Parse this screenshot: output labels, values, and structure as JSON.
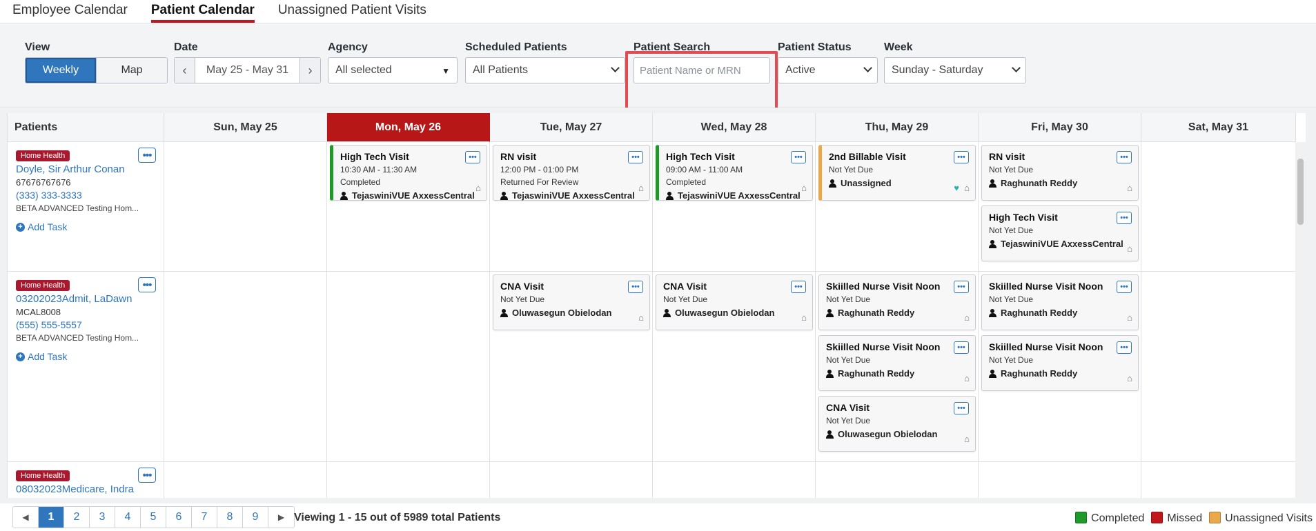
{
  "tabs": [
    "Employee Calendar",
    "Patient Calendar",
    "Unassigned Patient Visits"
  ],
  "filters": {
    "view_label": "View",
    "view_weekly": "Weekly",
    "view_map": "Map",
    "date_label": "Date",
    "date_value": "May 25 - May 31",
    "agency_label": "Agency",
    "agency_value": "All selected",
    "scheduled_label": "Scheduled Patients",
    "scheduled_value": "All Patients",
    "search_label": "Patient Search",
    "search_placeholder": "Patient Name or MRN",
    "status_label": "Patient Status",
    "status_value": "Active",
    "week_label": "Week",
    "week_value": "Sunday - Saturday"
  },
  "grid": {
    "patients_header": "Patients",
    "days": [
      "Sun, May 25",
      "Mon, May 26",
      "Tue, May 27",
      "Wed, May 28",
      "Thu, May 29",
      "Fri, May 30",
      "Sat, May 31"
    ]
  },
  "patients": [
    {
      "badge": "Home Health",
      "name": "Doyle, Sir Arthur Conan",
      "mrn": "67676767676",
      "phone": "(333) 333-3333",
      "agency": "BETA ADVANCED Testing Hom...",
      "add_task": "Add Task"
    },
    {
      "badge": "Home Health",
      "name": "03202023Admit, LaDawn",
      "mrn": "MCAL8008",
      "phone": "(555) 555-5557",
      "agency": "BETA ADVANCED Testing Hom...",
      "add_task": "Add Task"
    },
    {
      "badge": "Home Health",
      "name": "08032023Medicare, Indra"
    }
  ],
  "visits": [
    {
      "title": "High Tech Visit",
      "time": "10:30 AM - 11:30 AM",
      "status": "Completed",
      "user": "TejaswiniVUE AxxessCentral"
    },
    {
      "title": "RN visit",
      "time": "12:00 PM - 01:00 PM",
      "status": "Returned For Review",
      "user": "TejaswiniVUE AxxessCentral"
    },
    {
      "title": "High Tech Visit",
      "time": "09:00 AM - 11:00 AM",
      "status": "Completed",
      "user": "TejaswiniVUE AxxessCentral"
    },
    {
      "title": "2nd Billable Visit",
      "status": "Not Yet Due",
      "user": "Unassigned"
    },
    {
      "title": "RN visit",
      "status": "Not Yet Due",
      "user": "Raghunath Reddy"
    },
    {
      "title": "High Tech Visit",
      "status": "Not Yet Due",
      "user": "TejaswiniVUE AxxessCentral"
    },
    {
      "title": "CNA Visit",
      "status": "Not Yet Due",
      "user": "Oluwasegun Obielodan"
    },
    {
      "title": "CNA Visit",
      "status": "Not Yet Due",
      "user": "Oluwasegun Obielodan"
    },
    {
      "title": "Skiilled Nurse Visit Noon",
      "status": "Not Yet Due",
      "user": "Raghunath Reddy"
    },
    {
      "title": "Skiilled Nurse Visit Noon",
      "status": "Not Yet Due",
      "user": "Raghunath Reddy"
    },
    {
      "title": "CNA Visit",
      "status": "Not Yet Due",
      "user": "Oluwasegun Obielodan"
    },
    {
      "title": "Skiilled Nurse Visit Noon",
      "status": "Not Yet Due",
      "user": "Raghunath Reddy"
    },
    {
      "title": "Skiilled Nurse Visit Noon",
      "status": "Not Yet Due",
      "user": "Raghunath Reddy"
    }
  ],
  "footer": {
    "pages": [
      "1",
      "2",
      "3",
      "4",
      "5",
      "6",
      "7",
      "8",
      "9"
    ],
    "current_page": "1",
    "viewing": "Viewing 1 - 15 out of 5989 total Patients",
    "legend": [
      {
        "label": "Completed",
        "color": "#1f9a2a"
      },
      {
        "label": "Missed",
        "color": "#c0161c"
      },
      {
        "label": "Unassigned Visits",
        "color": "#e9a84a"
      }
    ]
  },
  "colors": {
    "accent": "#2f76bd",
    "today": "#b81718",
    "badge": "#a8192f",
    "highlight": "#e24b52"
  }
}
